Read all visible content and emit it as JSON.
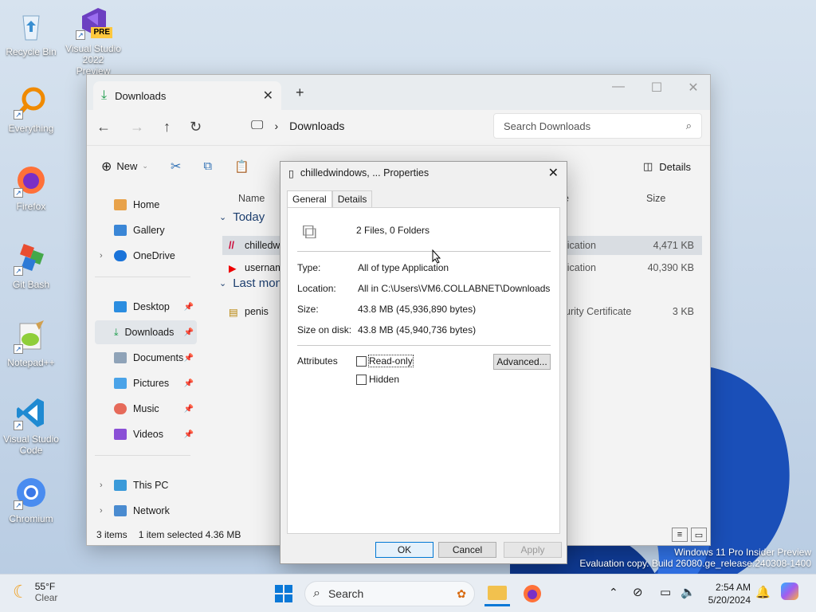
{
  "desktop": {
    "icons": [
      {
        "label": "Recycle Bin"
      },
      {
        "label": "Visual Studio 2022 Preview",
        "badge": "PRE"
      },
      {
        "label": "Everything"
      },
      {
        "label": "Firefox"
      },
      {
        "label": "Git Bash"
      },
      {
        "label": "Notepad++"
      },
      {
        "label": "Visual Studio Code"
      },
      {
        "label": "Chromium"
      }
    ],
    "watermark": {
      "line1": "Windows 11 Pro Insider Preview",
      "line2": "Evaluation copy. Build 26080.ge_release.240308-1400"
    }
  },
  "explorer": {
    "tab_label": "Downloads",
    "tab_close": "✕",
    "new_tab": "+",
    "window_controls": {
      "minimize": "—",
      "maximize": "☐",
      "close": "✕"
    },
    "address": {
      "location": "Downloads",
      "separator": "›"
    },
    "search_placeholder": "Search Downloads",
    "command_bar": {
      "new_label": "New",
      "details_label": "Details"
    },
    "nav": {
      "items": [
        {
          "label": "Home"
        },
        {
          "label": "Gallery"
        },
        {
          "label": "OneDrive"
        },
        {
          "label": "Desktop"
        },
        {
          "label": "Downloads"
        },
        {
          "label": "Documents"
        },
        {
          "label": "Pictures"
        },
        {
          "label": "Music"
        },
        {
          "label": "Videos"
        },
        {
          "label": "This PC"
        },
        {
          "label": "Network"
        }
      ]
    },
    "columns": {
      "name": "Name",
      "type": "e",
      "size": "Size"
    },
    "groups": {
      "today": "Today",
      "last_month": "Last mont"
    },
    "files": [
      {
        "name": "chilledw",
        "type": "lication",
        "size": "4,471 KB"
      },
      {
        "name": "usernam",
        "type": "lication",
        "size": "40,390 KB"
      },
      {
        "name": "penis",
        "type": "urity Certificate",
        "size": "3 KB"
      }
    ],
    "status": {
      "items": "3 items",
      "selected": "1 item selected  4.36 MB"
    }
  },
  "dialog": {
    "title": "chilledwindows, ... Properties",
    "tabs": {
      "general": "General",
      "details": "Details"
    },
    "summary": "2 Files, 0 Folders",
    "props": {
      "type_label": "Type:",
      "type_value": "All of type Application",
      "location_label": "Location:",
      "location_value": "All in C:\\Users\\VM6.COLLABNET\\Downloads",
      "size_label": "Size:",
      "size_value": "43.8 MB (45,936,890 bytes)",
      "size_on_disk_label": "Size on disk:",
      "size_on_disk_value": "43.8 MB (45,940,736 bytes)"
    },
    "attributes": {
      "label": "Attributes",
      "readonly": "Read-only",
      "hidden": "Hidden",
      "advanced": "Advanced..."
    },
    "buttons": {
      "ok": "OK",
      "cancel": "Cancel",
      "apply": "Apply"
    }
  },
  "taskbar": {
    "weather": {
      "temp": "55°F",
      "condition": "Clear"
    },
    "search_label": "Search",
    "clock": {
      "time": "2:54 AM",
      "date": "5/20/2024"
    }
  }
}
